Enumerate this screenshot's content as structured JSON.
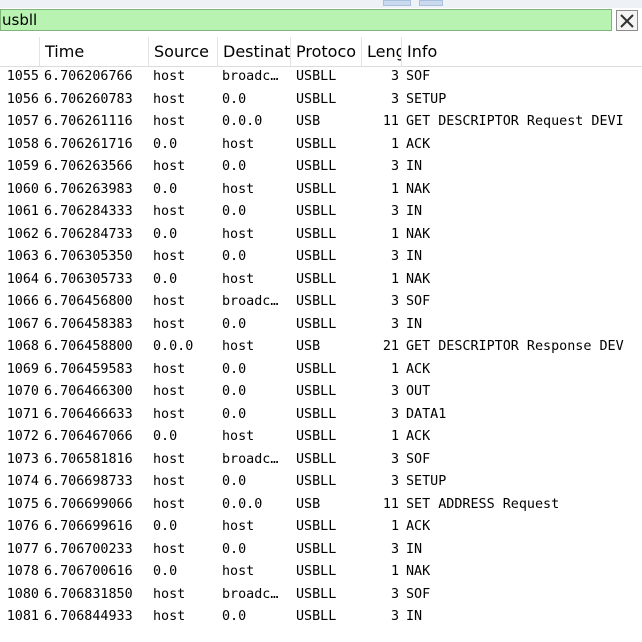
{
  "filter": {
    "value": "usbll"
  },
  "columns": {
    "no": "",
    "time": "Time",
    "source": "Source",
    "destination": "Destinat",
    "protocol": "Protoco",
    "length": "Leng",
    "info": "Info"
  },
  "packets": [
    {
      "no": "1055",
      "time": "6.706206766",
      "src": "host",
      "dst": "broadc…",
      "proto": "USBLL",
      "len": "3",
      "info": "SOF"
    },
    {
      "no": "1056",
      "time": "6.706260783",
      "src": "host",
      "dst": "0.0",
      "proto": "USBLL",
      "len": "3",
      "info": "SETUP"
    },
    {
      "no": "1057",
      "time": "6.706261116",
      "src": "host",
      "dst": "0.0.0",
      "proto": "USB",
      "len": "11",
      "info": "GET DESCRIPTOR Request DEVI"
    },
    {
      "no": "1058",
      "time": "6.706261716",
      "src": "0.0",
      "dst": "host",
      "proto": "USBLL",
      "len": "1",
      "info": "ACK"
    },
    {
      "no": "1059",
      "time": "6.706263566",
      "src": "host",
      "dst": "0.0",
      "proto": "USBLL",
      "len": "3",
      "info": "IN"
    },
    {
      "no": "1060",
      "time": "6.706263983",
      "src": "0.0",
      "dst": "host",
      "proto": "USBLL",
      "len": "1",
      "info": "NAK"
    },
    {
      "no": "1061",
      "time": "6.706284333",
      "src": "host",
      "dst": "0.0",
      "proto": "USBLL",
      "len": "3",
      "info": "IN"
    },
    {
      "no": "1062",
      "time": "6.706284733",
      "src": "0.0",
      "dst": "host",
      "proto": "USBLL",
      "len": "1",
      "info": "NAK"
    },
    {
      "no": "1063",
      "time": "6.706305350",
      "src": "host",
      "dst": "0.0",
      "proto": "USBLL",
      "len": "3",
      "info": "IN"
    },
    {
      "no": "1064",
      "time": "6.706305733",
      "src": "0.0",
      "dst": "host",
      "proto": "USBLL",
      "len": "1",
      "info": "NAK"
    },
    {
      "no": "1066",
      "time": "6.706456800",
      "src": "host",
      "dst": "broadc…",
      "proto": "USBLL",
      "len": "3",
      "info": "SOF"
    },
    {
      "no": "1067",
      "time": "6.706458383",
      "src": "host",
      "dst": "0.0",
      "proto": "USBLL",
      "len": "3",
      "info": "IN"
    },
    {
      "no": "1068",
      "time": "6.706458800",
      "src": "0.0.0",
      "dst": "host",
      "proto": "USB",
      "len": "21",
      "info": "GET DESCRIPTOR Response DEV"
    },
    {
      "no": "1069",
      "time": "6.706459583",
      "src": "host",
      "dst": "0.0",
      "proto": "USBLL",
      "len": "1",
      "info": "ACK"
    },
    {
      "no": "1070",
      "time": "6.706466300",
      "src": "host",
      "dst": "0.0",
      "proto": "USBLL",
      "len": "3",
      "info": "OUT"
    },
    {
      "no": "1071",
      "time": "6.706466633",
      "src": "host",
      "dst": "0.0",
      "proto": "USBLL",
      "len": "3",
      "info": "DATA1"
    },
    {
      "no": "1072",
      "time": "6.706467066",
      "src": "0.0",
      "dst": "host",
      "proto": "USBLL",
      "len": "1",
      "info": "ACK"
    },
    {
      "no": "1073",
      "time": "6.706581816",
      "src": "host",
      "dst": "broadc…",
      "proto": "USBLL",
      "len": "3",
      "info": "SOF"
    },
    {
      "no": "1074",
      "time": "6.706698733",
      "src": "host",
      "dst": "0.0",
      "proto": "USBLL",
      "len": "3",
      "info": "SETUP"
    },
    {
      "no": "1075",
      "time": "6.706699066",
      "src": "host",
      "dst": "0.0.0",
      "proto": "USB",
      "len": "11",
      "info": "SET ADDRESS Request"
    },
    {
      "no": "1076",
      "time": "6.706699616",
      "src": "0.0",
      "dst": "host",
      "proto": "USBLL",
      "len": "1",
      "info": "ACK"
    },
    {
      "no": "1077",
      "time": "6.706700233",
      "src": "host",
      "dst": "0.0",
      "proto": "USBLL",
      "len": "3",
      "info": "IN"
    },
    {
      "no": "1078",
      "time": "6.706700616",
      "src": "0.0",
      "dst": "host",
      "proto": "USBLL",
      "len": "1",
      "info": "NAK"
    },
    {
      "no": "1080",
      "time": "6.706831850",
      "src": "host",
      "dst": "broadc…",
      "proto": "USBLL",
      "len": "3",
      "info": "SOF"
    },
    {
      "no": "1081",
      "time": "6.706844933",
      "src": "host",
      "dst": "0.0",
      "proto": "USBLL",
      "len": "3",
      "info": "IN"
    }
  ]
}
